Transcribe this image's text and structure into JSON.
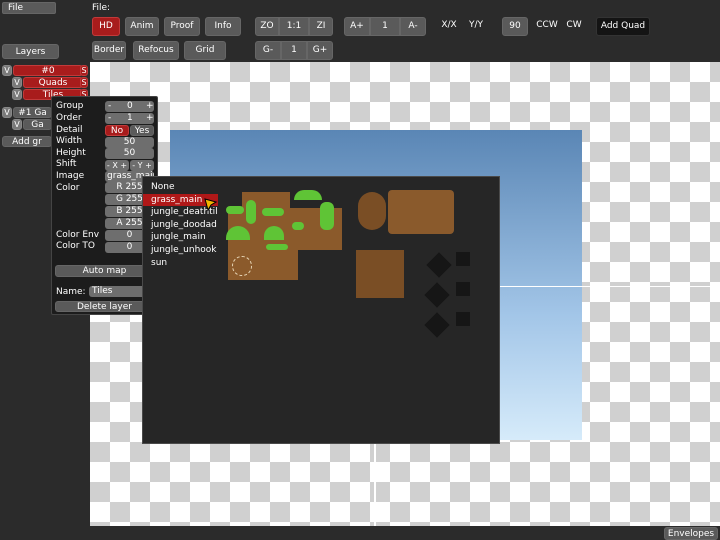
{
  "menu": {
    "file": "File",
    "file_path_label": "File:"
  },
  "toolbar": {
    "hd": "HD",
    "anim": "Anim",
    "proof": "Proof",
    "info": "Info",
    "zo": "ZO",
    "zoom_value": "1:1",
    "zi": "ZI",
    "a_plus": "A+",
    "a_value": "1",
    "a_minus": "A-",
    "flip_x": "X/X",
    "flip_y": "Y/Y",
    "rotate_angle": "90",
    "ccw": "CCW",
    "cw": "CW",
    "add_quad": "Add Quad",
    "border": "Border",
    "refocus": "Refocus",
    "grid": "Grid",
    "g_minus": "G-",
    "g_value": "1",
    "g_plus": "G+"
  },
  "layers": {
    "title": "Layers",
    "groups": [
      {
        "vis": "V",
        "name": "#0",
        "s": "S"
      },
      {
        "vis": "V",
        "name": "Quads",
        "s": "S"
      },
      {
        "vis": "V",
        "name": "Tiles",
        "s": "S"
      },
      {
        "vis": "V",
        "name": "#1 Ga",
        "s": ""
      },
      {
        "vis": "V",
        "name": "Ga",
        "s": ""
      }
    ],
    "add_group": "Add gr"
  },
  "props": {
    "group_label": "Group",
    "group_minus": "-",
    "group_value": "0",
    "group_plus": "+",
    "order_label": "Order",
    "order_minus": "-",
    "order_value": "1",
    "order_plus": "+",
    "detail_label": "Detail",
    "detail_no": "No",
    "detail_yes": "Yes",
    "width_label": "Width",
    "width_value": "50",
    "height_label": "Height",
    "height_value": "50",
    "shift_label": "Shift",
    "shift_x": "- X +",
    "shift_y": "- Y +",
    "image_label": "Image",
    "image_value": "grass_main",
    "color_label": "Color",
    "color_r": "R 255",
    "color_g": "G 255",
    "color_b": "B 255",
    "color_a": "A 255",
    "color_env_label": "Color Env",
    "color_env_value": "0",
    "color_to_label": "Color TO",
    "color_to_value": "0",
    "auto_map": "Auto map",
    "name_label": "Name:",
    "name_value": "Tiles",
    "delete_layer": "Delete layer"
  },
  "image_dropdown": {
    "options": [
      "None",
      "grass_main",
      "jungle_deathtil",
      "jungle_doodad",
      "jungle_main",
      "jungle_unhook",
      "sun"
    ],
    "selected": "grass_main"
  },
  "status": {
    "envelopes": "Envelopes"
  },
  "colors": {
    "accent_red": "#a81c1c",
    "panel_bg": "#2b2b2b",
    "sky_top": "#5a86b5",
    "sky_bottom": "#cfe5f7",
    "grass": "#5fc436",
    "dirt": "#8b5a2b"
  },
  "icons": {
    "cursor": "pointer-arrow-icon"
  }
}
